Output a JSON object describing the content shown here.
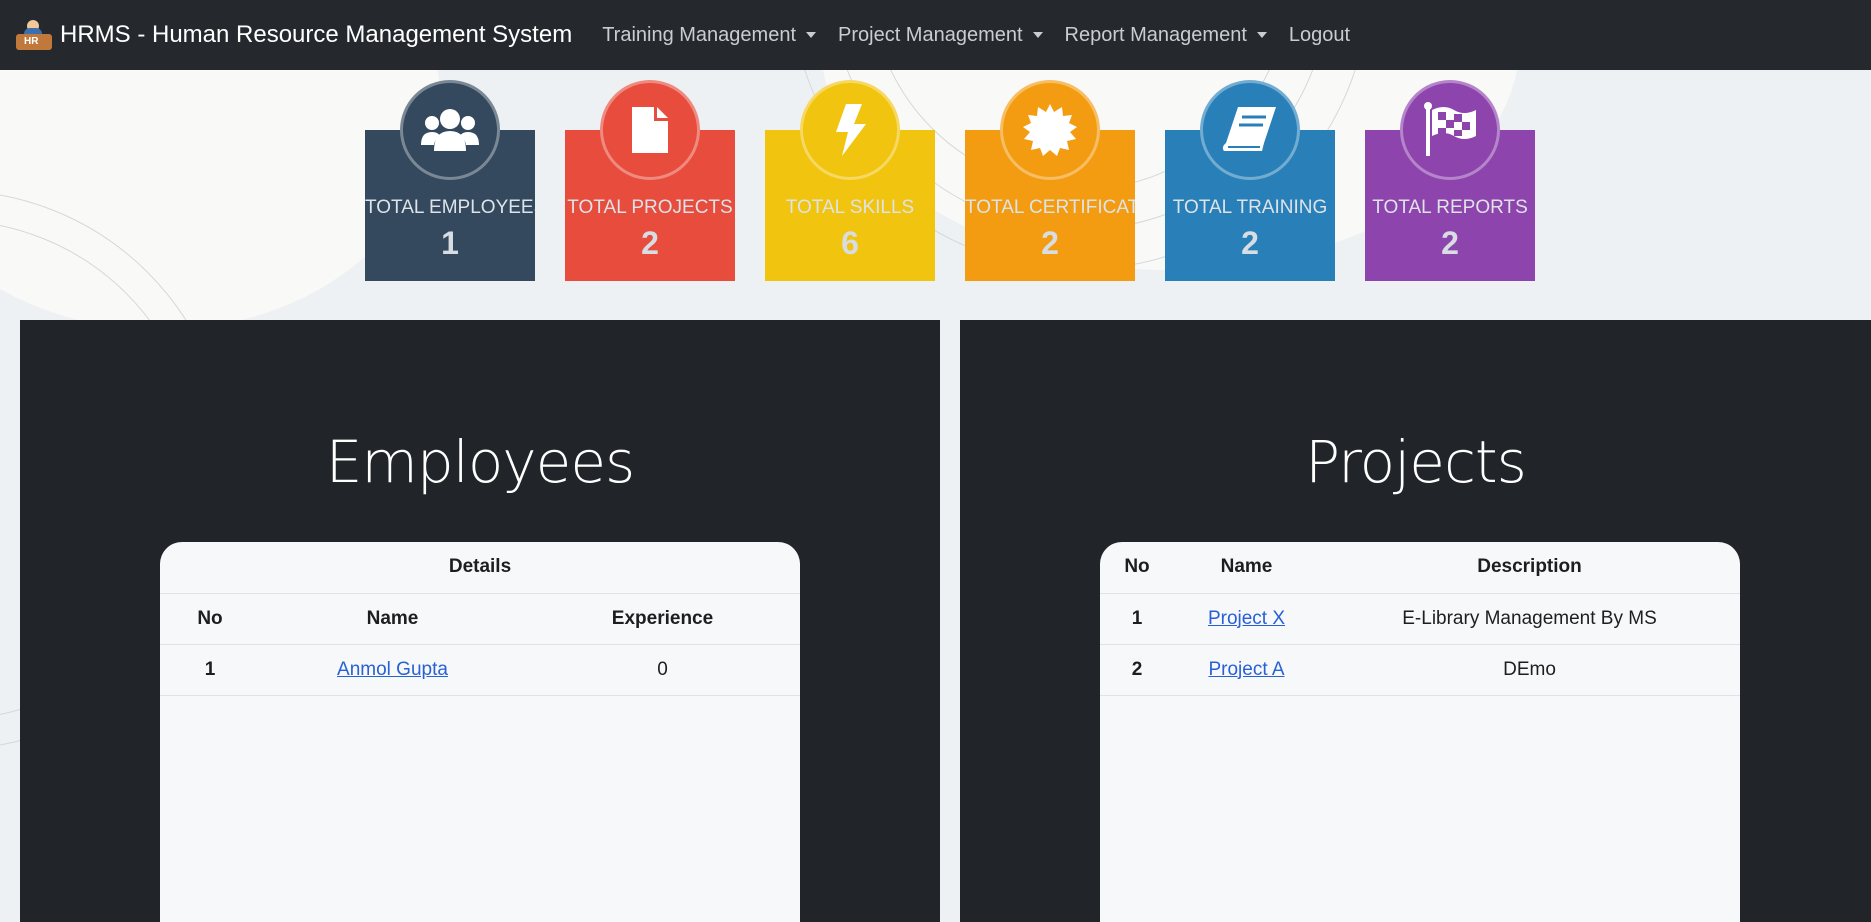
{
  "navbar": {
    "brand_title": "HRMS - Human Resource Management System",
    "brand_logo_text": "HR",
    "items": [
      {
        "label": "Training Management",
        "dropdown": true
      },
      {
        "label": "Project Management",
        "dropdown": true
      },
      {
        "label": "Report Management",
        "dropdown": true
      },
      {
        "label": "Logout",
        "dropdown": false
      }
    ]
  },
  "stats": [
    {
      "label": "TOTAL EMPLOYEES",
      "value": "1",
      "color": "#34495e",
      "icon": "users-icon"
    },
    {
      "label": "TOTAL PROJECTS",
      "value": "2",
      "color": "#e74c3c",
      "icon": "file-icon"
    },
    {
      "label": "TOTAL SKILLS",
      "value": "6",
      "color": "#f1c40f",
      "icon": "bolt-icon"
    },
    {
      "label": "TOTAL CERTIFICATE",
      "value": "2",
      "color": "#f39c12",
      "icon": "certificate-icon"
    },
    {
      "label": "TOTAL TRAINING",
      "value": "2",
      "color": "#2980b9",
      "icon": "book-icon"
    },
    {
      "label": "TOTAL REPORTS",
      "value": "2",
      "color": "#8e44ad",
      "icon": "flag-checkered-icon"
    }
  ],
  "employees": {
    "title": "Employees",
    "group_header": "Details",
    "columns": [
      "No",
      "Name",
      "Experience"
    ],
    "rows": [
      {
        "no": "1",
        "name": "Anmol Gupta",
        "experience": "0"
      }
    ]
  },
  "projects": {
    "title": "Projects",
    "columns": [
      "No",
      "Name",
      "Description"
    ],
    "rows": [
      {
        "no": "1",
        "name": "Project X",
        "description": "E-Library Management By MS"
      },
      {
        "no": "2",
        "name": "Project A",
        "description": "DEmo"
      }
    ]
  }
}
